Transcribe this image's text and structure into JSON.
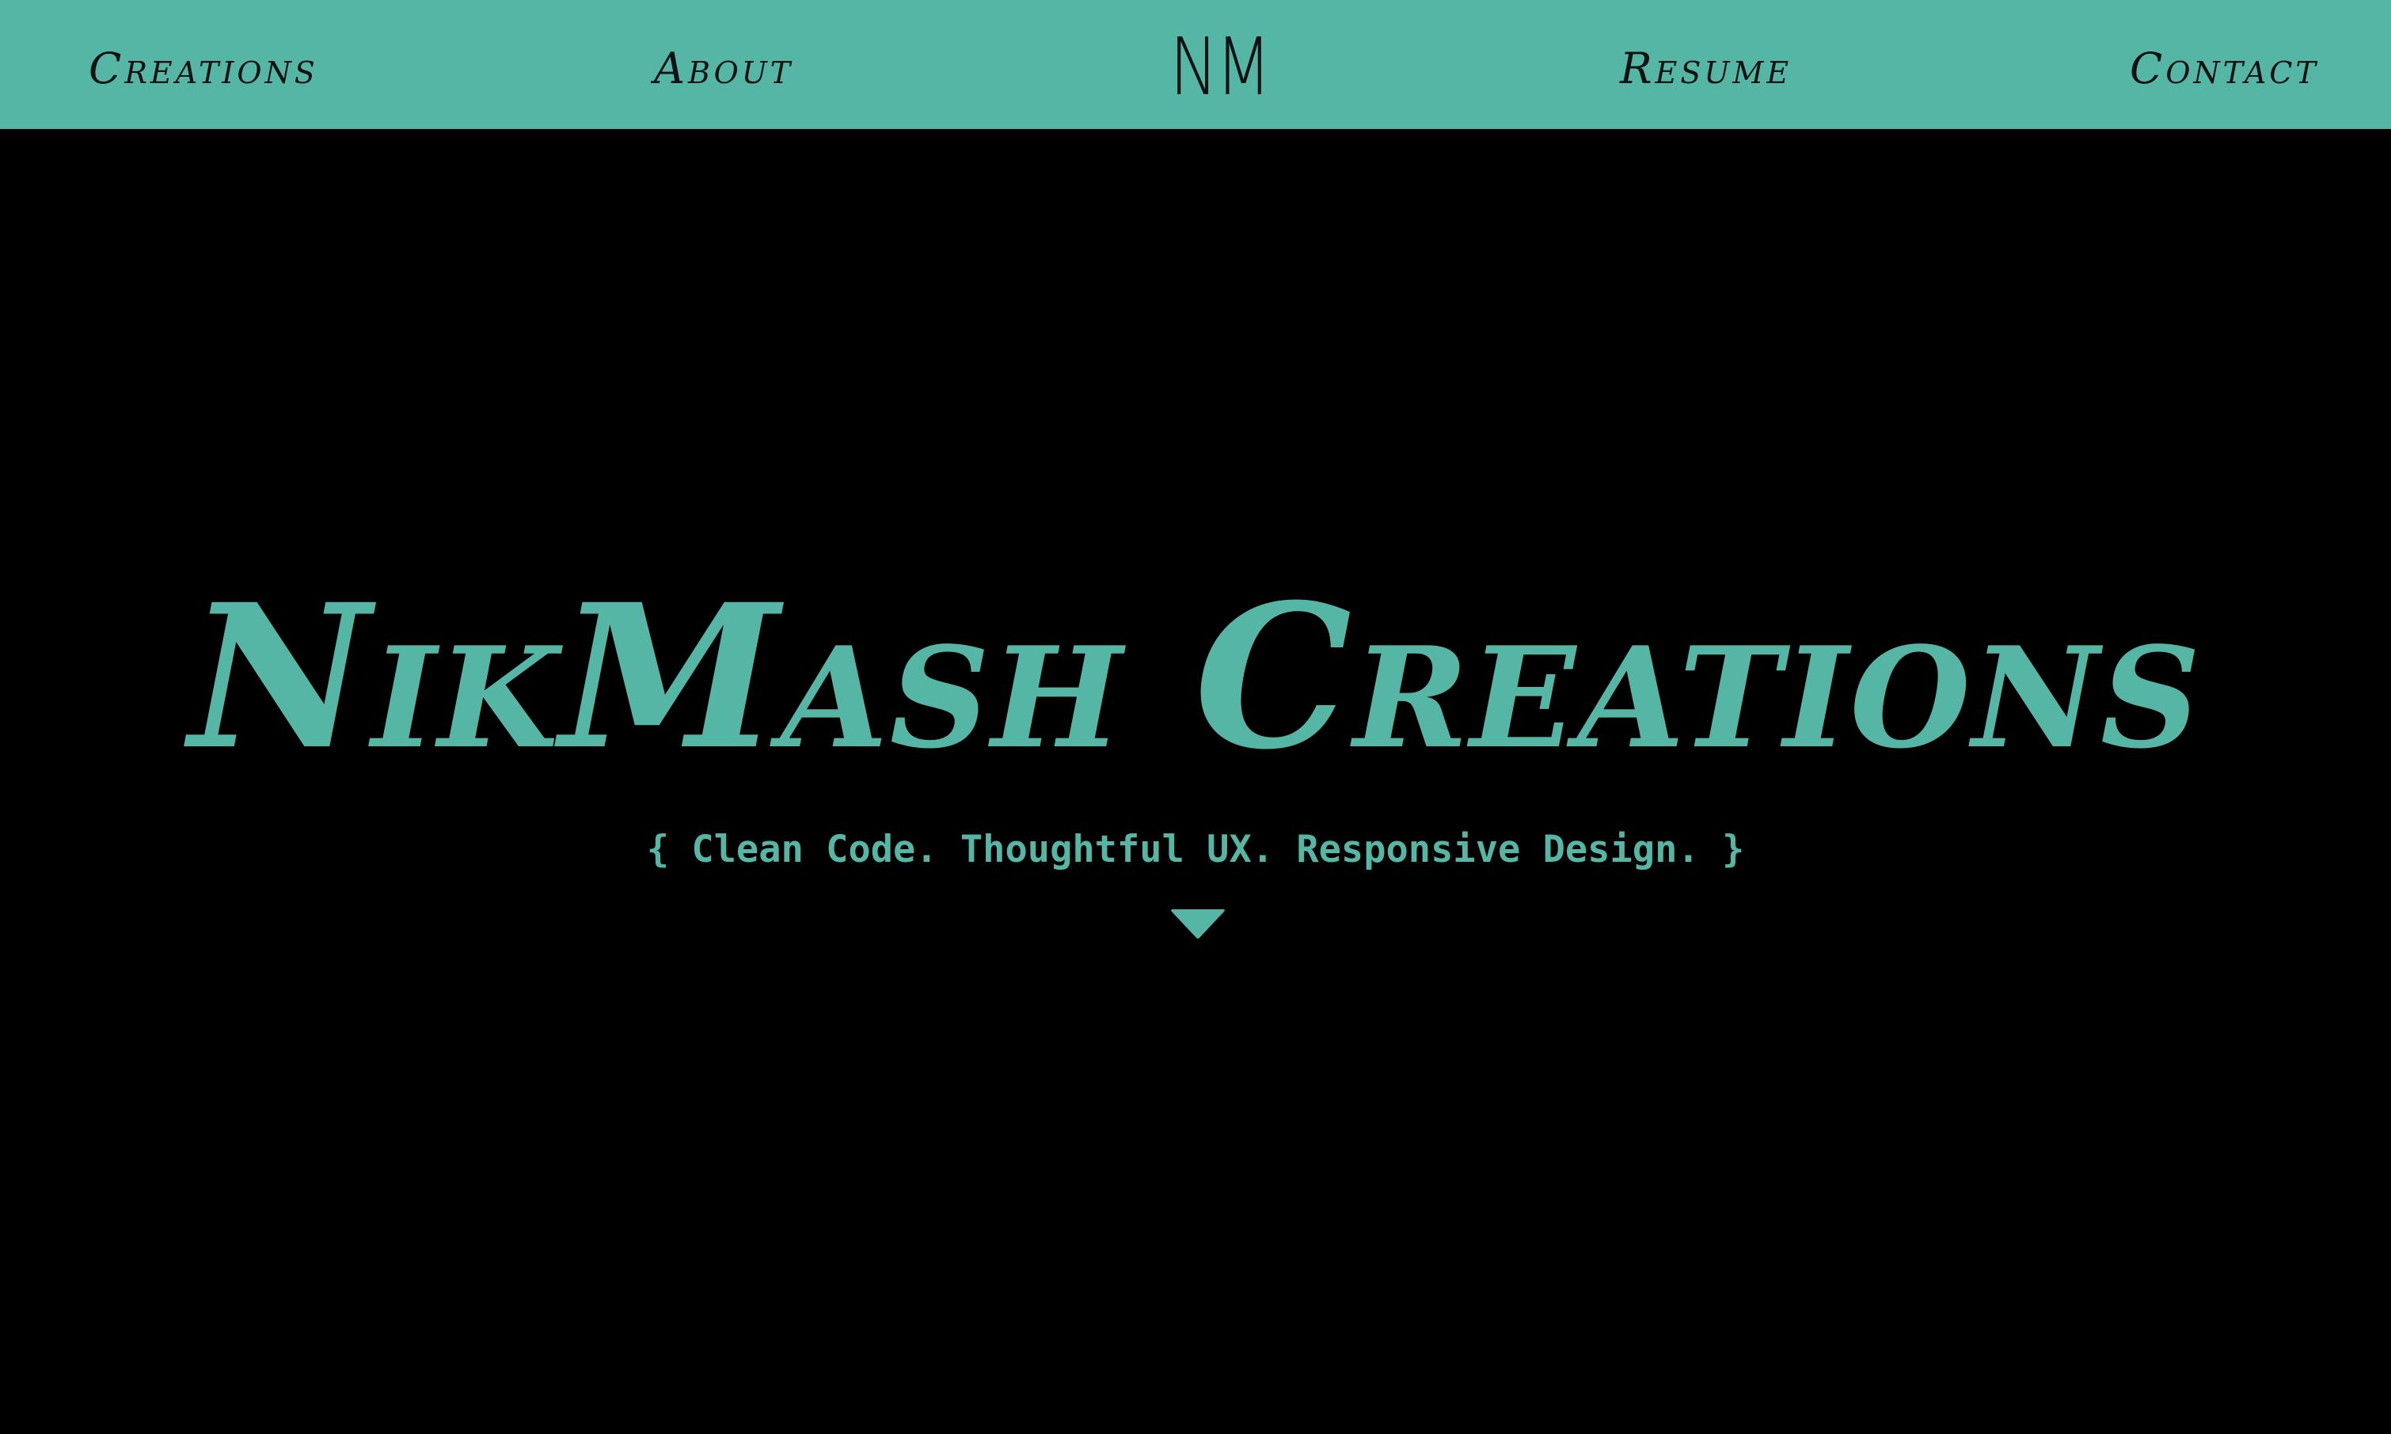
{
  "nav": {
    "creations_label": "Creations",
    "about_label": "About",
    "logo_text": "NM",
    "resume_label": "Resume",
    "contact_label": "Contact"
  },
  "hero": {
    "title": "NikMash Creations",
    "tagline": "{ Clean Code. Thoughtful UX. Responsive Design. }",
    "scroll_icon": "chevron-down-icon"
  },
  "colors": {
    "accent": "#56b6a5",
    "background": "#000000",
    "nav_text": "#111111"
  }
}
